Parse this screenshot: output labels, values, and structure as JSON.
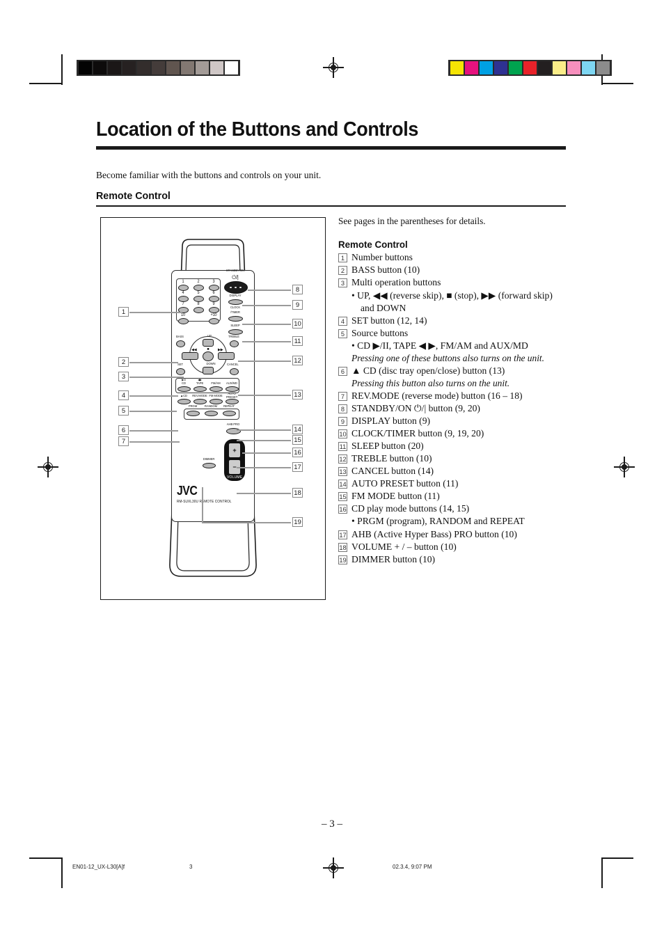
{
  "page": {
    "title": "Location of the Buttons and Controls",
    "intro": "Become familiar with the buttons and controls on your unit.",
    "section_heading": "Remote Control",
    "page_number": "– 3 –"
  },
  "legend": {
    "see_note": "See pages in the parentheses for details.",
    "heading": "Remote Control",
    "items": [
      {
        "num": "1",
        "text": "Number buttons"
      },
      {
        "num": "2",
        "text": "BASS button (10)"
      },
      {
        "num": "3",
        "text": "Multi operation buttons",
        "sub": "• UP, ◀◀ (reverse skip), ■ (stop), ▶▶ (forward skip)",
        "cont": "and DOWN"
      },
      {
        "num": "4",
        "text": "SET button (12, 14)"
      },
      {
        "num": "5",
        "text": "Source buttons",
        "sub": "• CD ▶/II, TAPE ◀ ▶, FM/AM and AUX/MD",
        "note": "Pressing one of these buttons also turns on the unit."
      },
      {
        "num": "6",
        "text": "▲ CD (disc tray open/close) button (13)",
        "note": "Pressing this button also turns on the unit."
      },
      {
        "num": "7",
        "text": "REV.MODE (reverse mode) button (16 – 18)"
      },
      {
        "num": "8",
        "text": "STANDBY/ON ⏻/| button (9, 20)"
      },
      {
        "num": "9",
        "text": "DISPLAY button (9)"
      },
      {
        "num": "10",
        "text": "CLOCK/TIMER button (9, 19, 20)"
      },
      {
        "num": "11",
        "text": "SLEEP button (20)"
      },
      {
        "num": "12",
        "text": "TREBLE button (10)"
      },
      {
        "num": "13",
        "text": "CANCEL button (14)"
      },
      {
        "num": "14",
        "text": "AUTO PRESET button (11)"
      },
      {
        "num": "15",
        "text": "FM MODE button (11)"
      },
      {
        "num": "16",
        "text": "CD play mode buttons (14, 15)",
        "sub": "• PRGM (program), RANDOM and REPEAT"
      },
      {
        "num": "17",
        "text": "AHB (Active Hyper Bass) PRO button (10)"
      },
      {
        "num": "18",
        "text": "VOLUME + / – button (10)"
      },
      {
        "num": "19",
        "text": "DIMMER button (10)"
      }
    ]
  },
  "remote": {
    "brand": "JVC",
    "model": "RM-SUXL30U REMOTE CONTROL",
    "standby_label": "STANDBY/ON",
    "standby_symbol": "⏻/|",
    "number_keys": [
      "1",
      "2",
      "3",
      "4",
      "5",
      "6",
      "7",
      "8",
      "9",
      "10",
      "+10"
    ],
    "right_column": [
      "DISPLAY",
      "CLOCK",
      "/TIMER",
      "SLEEP"
    ],
    "tone": {
      "bass": "BASS",
      "treble": "TREBLE"
    },
    "nav": {
      "up": "UP",
      "down": "DOWN",
      "rew": "◀◀",
      "ffw": "▶▶",
      "stop": "■"
    },
    "set_cancel": {
      "set": "SET",
      "cancel": "CANCEL"
    },
    "source_buttons": [
      {
        "top": "▶/II",
        "label": "CD"
      },
      {
        "top": "◀▶",
        "label": "TAPE"
      },
      {
        "top": "",
        "label": "FM/AM"
      },
      {
        "top": "",
        "label": "AUX/MD"
      }
    ],
    "function_row": [
      "▲CD",
      "REV.MODE",
      "FM MODE",
      "AUTO PRESET"
    ],
    "play_mode_row": [
      "PRGM",
      "RANDOM",
      "REPEAT"
    ],
    "ahb": "AHB PRO",
    "dimmer": "DIMMER",
    "volume": {
      "label": "VOLUME",
      "plus": "+",
      "minus": "−"
    }
  },
  "callouts_left": [
    "1",
    "2",
    "3",
    "4",
    "5",
    "6",
    "7"
  ],
  "callouts_right": [
    "8",
    "9",
    "10",
    "11",
    "12",
    "13",
    "14",
    "15",
    "16",
    "17",
    "18",
    "19"
  ],
  "footer": {
    "file": "EN01-12_UX-L30[A]f",
    "page": "3",
    "timestamp": "02.3.4, 9:07 PM"
  },
  "colors": {
    "grayscale_strip": [
      "#030303",
      "#0d0b0b",
      "#1b1717",
      "#262121",
      "#332d2c",
      "#443c3a",
      "#60554f",
      "#827872",
      "#a39b97",
      "#cfc7c6",
      "#ffffff"
    ],
    "color_strip": [
      "#f5e404",
      "#e6127e",
      "#00a0e3",
      "#2e3192",
      "#00a34f",
      "#e8222a",
      "#231f20",
      "#faed89",
      "#f78fbd",
      "#7ed6f2",
      "#8c8c8c"
    ]
  }
}
